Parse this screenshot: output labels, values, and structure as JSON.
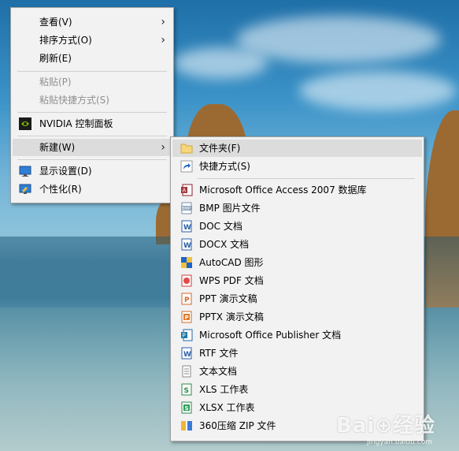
{
  "context_menu": {
    "items": [
      {
        "label": "查看(V)",
        "has_submenu": true,
        "enabled": true
      },
      {
        "label": "排序方式(O)",
        "has_submenu": true,
        "enabled": true
      },
      {
        "label": "刷新(E)",
        "enabled": true
      },
      {
        "label": "粘贴(P)",
        "enabled": false
      },
      {
        "label": "粘贴快捷方式(S)",
        "enabled": false
      },
      {
        "label": "NVIDIA 控制面板",
        "enabled": true,
        "icon": "nvidia-icon"
      },
      {
        "label": "新建(W)",
        "has_submenu": true,
        "enabled": true,
        "selected": true
      },
      {
        "label": "显示设置(D)",
        "enabled": true,
        "icon": "display-icon"
      },
      {
        "label": "个性化(R)",
        "enabled": true,
        "icon": "personalize-icon"
      }
    ]
  },
  "new_submenu": {
    "items": [
      {
        "label": "文件夹(F)",
        "icon": "folder-icon",
        "selected": true
      },
      {
        "label": "快捷方式(S)",
        "icon": "shortcut-icon"
      },
      {
        "label": "Microsoft Office Access 2007 数据库",
        "icon": "access-icon"
      },
      {
        "label": "BMP 图片文件",
        "icon": "bmp-icon"
      },
      {
        "label": "DOC 文档",
        "icon": "doc-icon"
      },
      {
        "label": "DOCX 文档",
        "icon": "docx-icon"
      },
      {
        "label": "AutoCAD 图形",
        "icon": "autocad-icon"
      },
      {
        "label": "WPS PDF 文档",
        "icon": "pdf-icon"
      },
      {
        "label": "PPT 演示文稿",
        "icon": "ppt-icon"
      },
      {
        "label": "PPTX 演示文稿",
        "icon": "pptx-icon"
      },
      {
        "label": "Microsoft Office Publisher 文档",
        "icon": "publisher-icon"
      },
      {
        "label": "RTF 文件",
        "icon": "rtf-icon"
      },
      {
        "label": "文本文档",
        "icon": "text-doc-icon"
      },
      {
        "label": "XLS 工作表",
        "icon": "xls-icon"
      },
      {
        "label": "XLSX 工作表",
        "icon": "xlsx-icon"
      },
      {
        "label": "360压缩 ZIP 文件",
        "icon": "zip-icon"
      }
    ]
  },
  "watermark": {
    "text": "Bai⊕经验",
    "subtext": "jingyan.baidu.com"
  },
  "colors": {
    "menu_bg": "#f2f2f2",
    "hover": "#dcdcdc",
    "disabled_text": "#8f8f8f",
    "nvidia_green": "#76b900"
  }
}
